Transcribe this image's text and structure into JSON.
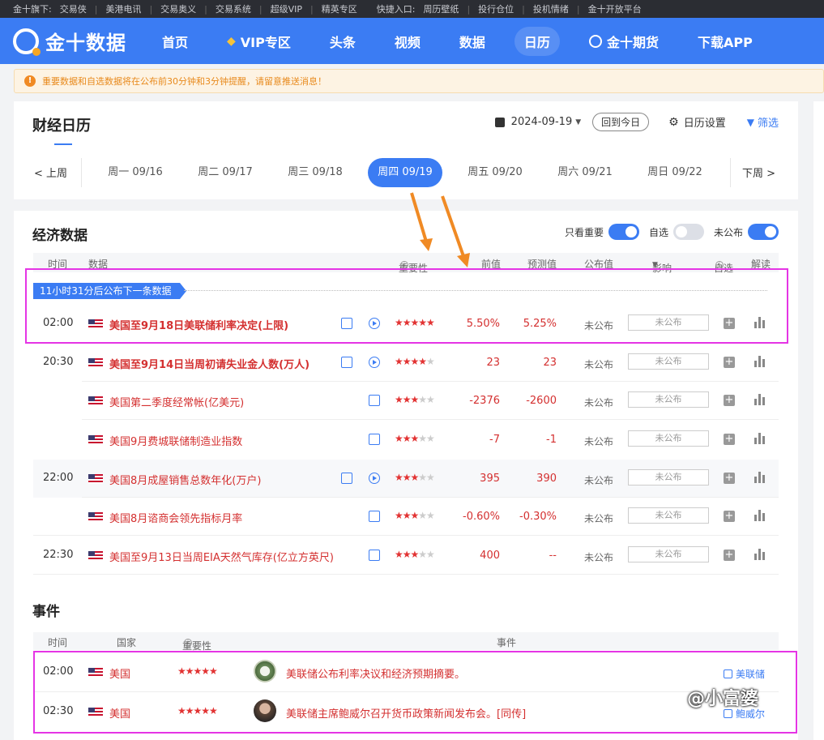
{
  "topbar": {
    "items": [
      "金十旗下:",
      "交易侠",
      "美港电讯",
      "交易奥义",
      "交易系统",
      "超级VIP",
      "精英专区"
    ],
    "quick_label": "快捷入口:",
    "quick_items": [
      "周历壁纸",
      "投行仓位",
      "投机情绪",
      "金十开放平台"
    ]
  },
  "nav": {
    "logo": "金十数据",
    "items": [
      "首页",
      "VIP专区",
      "头条",
      "视频",
      "数据",
      "日历",
      "金十期货",
      "下载APP"
    ],
    "active": "日历"
  },
  "notice": "重要数据和自选数据将在公布前30分钟和3分钟提醒，请留意推送消息！",
  "calendar": {
    "title": "财经日历",
    "date": "2024-09-19",
    "today_button": "回到今日",
    "settings": "日历设置",
    "filter": "筛选",
    "prev_week": "上周",
    "next_week": "下周",
    "days": [
      "周一 09/16",
      "周二 09/17",
      "周三 09/18",
      "周四 09/19",
      "周五 09/20",
      "周六 09/21",
      "周日 09/22"
    ],
    "active_day": "周四 09/19"
  },
  "econ": {
    "title": "经济数据",
    "toggles": [
      {
        "label": "只看重要",
        "on": true
      },
      {
        "label": "自选",
        "on": false
      },
      {
        "label": "未公布",
        "on": true
      }
    ],
    "headers": {
      "time": "时间",
      "data": "数据",
      "importance": "重要性",
      "previous": "前值",
      "forecast": "预测值",
      "actual": "公布值",
      "impact": "影响",
      "watch": "自选",
      "analysis": "解读"
    },
    "countdown": "11小时31分后公布下一条数据",
    "rows": [
      {
        "time": "02:00",
        "name": "美国至9月18日美联储利率决定(上限)",
        "stars": 5,
        "prev": "5.50%",
        "forecast": "5.25%",
        "status": "未公布",
        "box": "未公布",
        "video": true,
        "bold": true
      },
      {
        "time": "20:30",
        "name": "美国至9月14日当周初请失业金人数(万人)",
        "stars": 4,
        "prev": "23",
        "forecast": "23",
        "status": "未公布",
        "box": "未公布",
        "video": true,
        "bold": true
      },
      {
        "time": "",
        "name": "美国第二季度经常帐(亿美元)",
        "stars": 3,
        "prev": "-2376",
        "forecast": "-2600",
        "status": "未公布",
        "box": "未公布",
        "video": false,
        "bold": false
      },
      {
        "time": "",
        "name": "美国9月费城联储制造业指数",
        "stars": 3,
        "prev": "-7",
        "forecast": "-1",
        "status": "未公布",
        "box": "未公布",
        "video": false,
        "bold": false
      },
      {
        "time": "22:00",
        "name": "美国8月成屋销售总数年化(万户)",
        "stars": 3,
        "prev": "395",
        "forecast": "390",
        "status": "未公布",
        "box": "未公布",
        "video": true,
        "bold": false
      },
      {
        "time": "",
        "name": "美国8月谘商会领先指标月率",
        "stars": 3,
        "prev": "-0.60%",
        "forecast": "-0.30%",
        "status": "未公布",
        "box": "未公布",
        "video": false,
        "bold": false
      },
      {
        "time": "22:30",
        "name": "美国至9月13日当周EIA天然气库存(亿立方英尺)",
        "stars": 3,
        "prev": "400",
        "forecast": "--",
        "status": "未公布",
        "box": "未公布",
        "video": false,
        "bold": false
      }
    ]
  },
  "events": {
    "title": "事件",
    "headers": {
      "time": "时间",
      "country": "国家",
      "importance": "重要性",
      "event": "事件"
    },
    "rows": [
      {
        "time": "02:00",
        "country": "美国",
        "stars": 5,
        "text": "美联储公布利率决议和经济预期摘要。",
        "tag": "美联储"
      },
      {
        "time": "02:30",
        "country": "美国",
        "stars": 5,
        "text": "美联储主席鲍威尔召开货币政策新闻发布会。[同传]",
        "tag": "鲍威尔"
      }
    ]
  },
  "signature": "@小富婆",
  "colors": {
    "brand": "#3b7cf3",
    "value_red": "#d43030",
    "highlight": "#e535e5",
    "arrow": "#f08a24"
  }
}
